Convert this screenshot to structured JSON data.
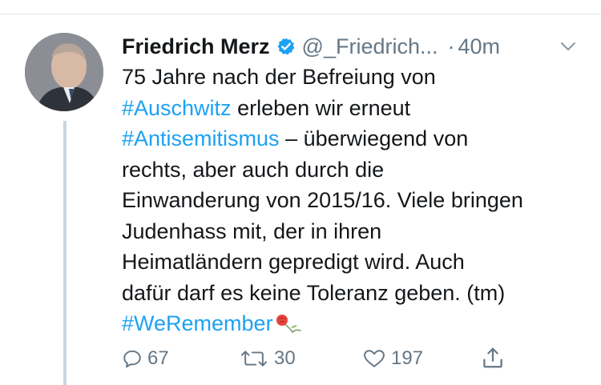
{
  "tweet": {
    "author": {
      "display_name": "Friedrich Merz",
      "handle": "@_Friedrich...",
      "verified": true
    },
    "separator": "·",
    "timestamp": "40m",
    "text_lines": [
      {
        "parts": [
          {
            "t": "75 Jahre nach der Befreiung von",
            "tag": false
          }
        ]
      },
      {
        "parts": [
          {
            "t": "#Auschwitz",
            "tag": true
          },
          {
            "t": " erleben wir erneut",
            "tag": false
          }
        ]
      },
      {
        "parts": [
          {
            "t": "#Antisemitismus",
            "tag": true
          },
          {
            "t": " – überwiegend von",
            "tag": false
          }
        ]
      },
      {
        "parts": [
          {
            "t": "rechts, aber auch durch die",
            "tag": false
          }
        ]
      },
      {
        "parts": [
          {
            "t": "Einwanderung von 2015/16. Viele bringen",
            "tag": false
          }
        ]
      },
      {
        "parts": [
          {
            "t": "Judenhass mit, der in ihren",
            "tag": false
          }
        ]
      },
      {
        "parts": [
          {
            "t": "Heimatländern gepredigt wird. Auch",
            "tag": false
          }
        ]
      },
      {
        "parts": [
          {
            "t": "dafür darf es keine Toleranz geben. (tm)",
            "tag": false
          }
        ]
      },
      {
        "parts": [
          {
            "t": "#WeRemember",
            "tag": true
          }
        ]
      }
    ],
    "actions": {
      "reply_count": "67",
      "retweet_count": "30",
      "like_count": "197"
    }
  },
  "colors": {
    "hashtag": "#1da1f2",
    "muted": "#657786",
    "verified": "#1da1f2",
    "thread_line": "#ccd6dd"
  },
  "icons": [
    "verified-badge-icon",
    "chevron-down-icon",
    "rose-emoji-icon",
    "reply-icon",
    "retweet-icon",
    "like-icon",
    "share-icon"
  ]
}
